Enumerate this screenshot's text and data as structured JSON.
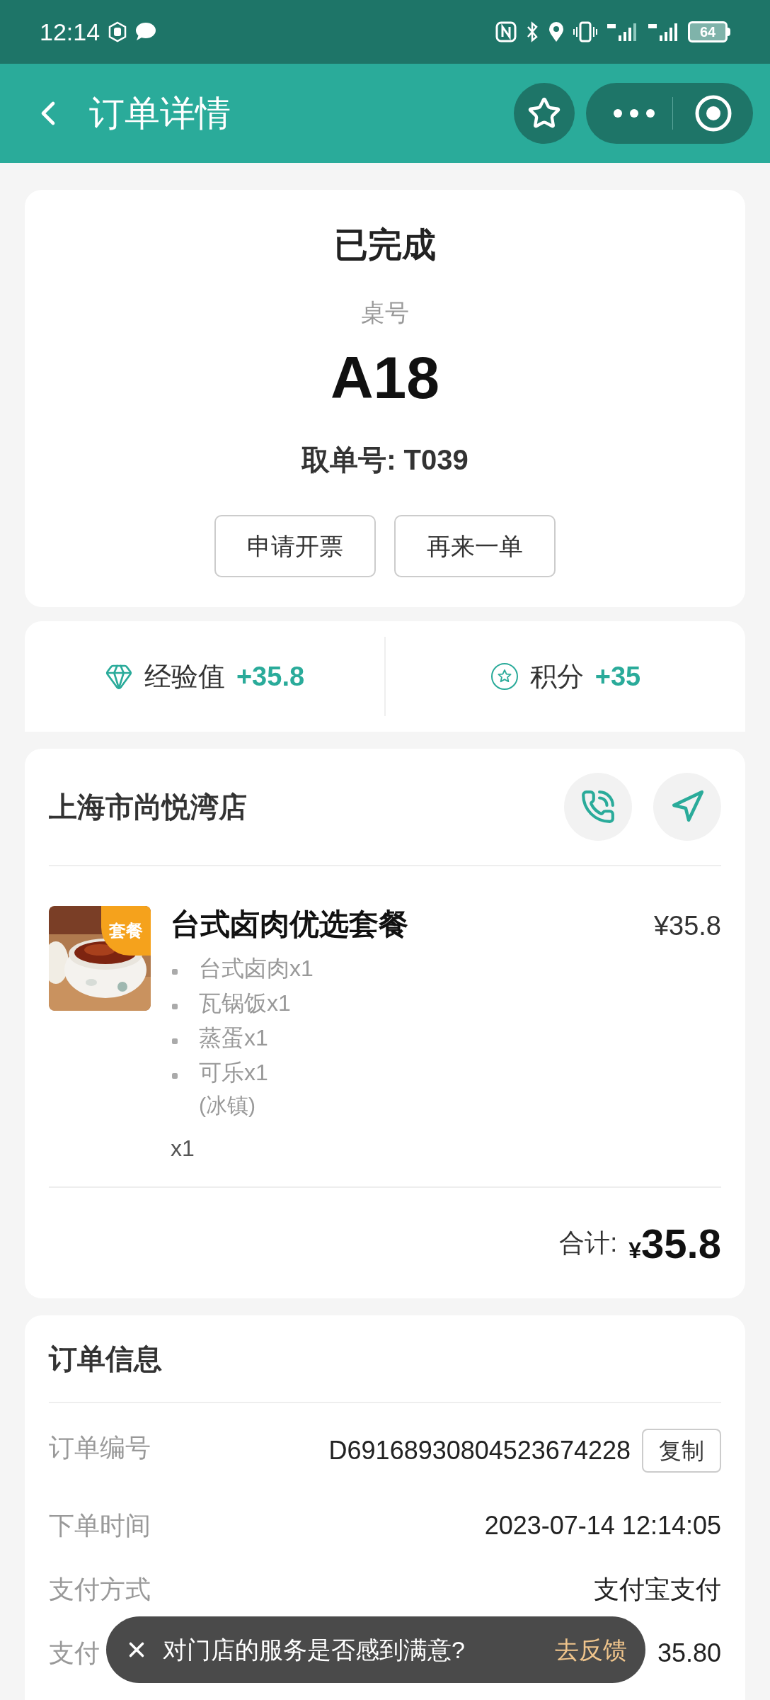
{
  "status_bar": {
    "time": "12:14",
    "battery": "64"
  },
  "header": {
    "title": "订单详情"
  },
  "order_status": {
    "status": "已完成",
    "table_label": "桌号",
    "table_number": "A18",
    "pickup": "取单号: T039",
    "buttons": [
      "申请开票",
      "再来一单"
    ]
  },
  "rewards": [
    {
      "kind": "experience",
      "label": "经验值",
      "value": "+35.8"
    },
    {
      "kind": "points",
      "label": "积分",
      "value": "+35"
    }
  ],
  "store": {
    "name": "上海市尚悦湾店",
    "item": {
      "badge": "套餐",
      "name": "台式卤肉优选套餐",
      "price": "¥35.8",
      "components": [
        "台式卤肉x1",
        "瓦锅饭x1",
        "蒸蛋x1",
        "可乐x1"
      ],
      "note": "(冰镇)",
      "quantity": "x1"
    },
    "total_label": "合计:",
    "currency": "¥",
    "total": "35.8"
  },
  "order_info": {
    "title": "订单信息",
    "copy_button": "复制",
    "rows": [
      {
        "label": "订单编号",
        "value": "D69168930804523674228"
      },
      {
        "label": "下单时间",
        "value": "2023-07-14 12:14:05"
      },
      {
        "label": "支付方式",
        "value": "支付宝支付"
      },
      {
        "label": "支付",
        "value": "35.80"
      }
    ]
  },
  "toast": {
    "message": "对门店的服务是否感到满意?",
    "action": "去反馈"
  }
}
